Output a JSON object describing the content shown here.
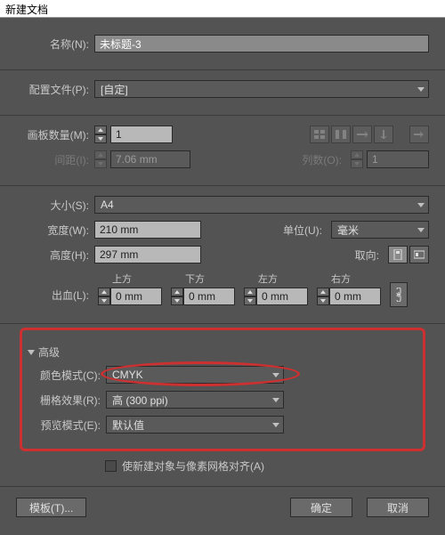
{
  "window": {
    "title": "新建文档"
  },
  "name": {
    "label": "名称(N):",
    "value": "未标题-3"
  },
  "profile": {
    "label": "配置文件(P):",
    "value": "[自定]"
  },
  "artboards": {
    "label": "画板数量(M):",
    "value": "1"
  },
  "spacing": {
    "label": "间距(I):",
    "value": "7.06 mm"
  },
  "columns": {
    "label": "列数(O):",
    "value": "1"
  },
  "size": {
    "label": "大小(S):",
    "value": "A4"
  },
  "width": {
    "label": "宽度(W):",
    "value": "210 mm"
  },
  "height": {
    "label": "高度(H):",
    "value": "297 mm"
  },
  "units": {
    "label": "单位(U):",
    "value": "毫米"
  },
  "orientation": {
    "label": "取向:"
  },
  "bleed": {
    "label": "出血(L):",
    "top": {
      "head": "上方",
      "value": "0 mm"
    },
    "bottom": {
      "head": "下方",
      "value": "0 mm"
    },
    "left": {
      "head": "左方",
      "value": "0 mm"
    },
    "right": {
      "head": "右方",
      "value": "0 mm"
    }
  },
  "advanced": {
    "title": "高级",
    "colorMode": {
      "label": "颜色模式(C):",
      "value": "CMYK"
    },
    "raster": {
      "label": "栅格效果(R):",
      "value": "高 (300 ppi)"
    },
    "preview": {
      "label": "预览模式(E):",
      "value": "默认值"
    },
    "alignGrid": {
      "label": "使新建对象与像素网格对齐(A)"
    }
  },
  "footer": {
    "template": "模板(T)...",
    "ok": "确定",
    "cancel": "取消"
  }
}
